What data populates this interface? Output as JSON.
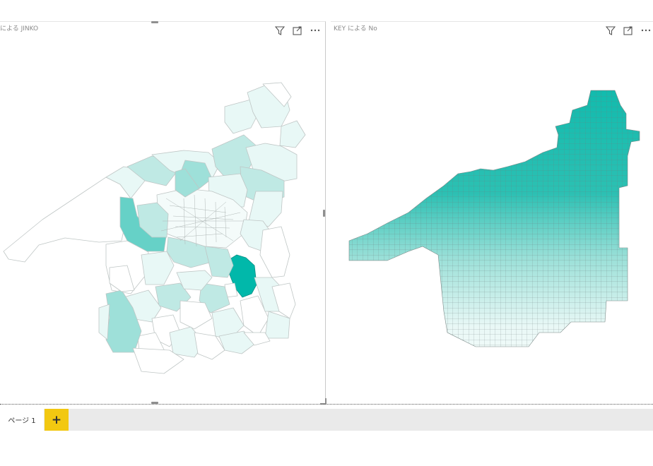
{
  "colors": {
    "accent": "#01b8aa",
    "light_fill": "#e8f8f6",
    "tab_add": "#f2c811"
  },
  "left_visual": {
    "title": "による JINKO",
    "icons": [
      "filter-icon",
      "focus-mode-icon",
      "more-options-icon"
    ]
  },
  "right_visual": {
    "title": "KEY による No",
    "icons": [
      "filter-icon",
      "focus-mode-icon",
      "more-options-icon"
    ]
  },
  "pages": {
    "tabs": [
      {
        "label": "ページ 1"
      }
    ],
    "add_label": "+"
  }
}
